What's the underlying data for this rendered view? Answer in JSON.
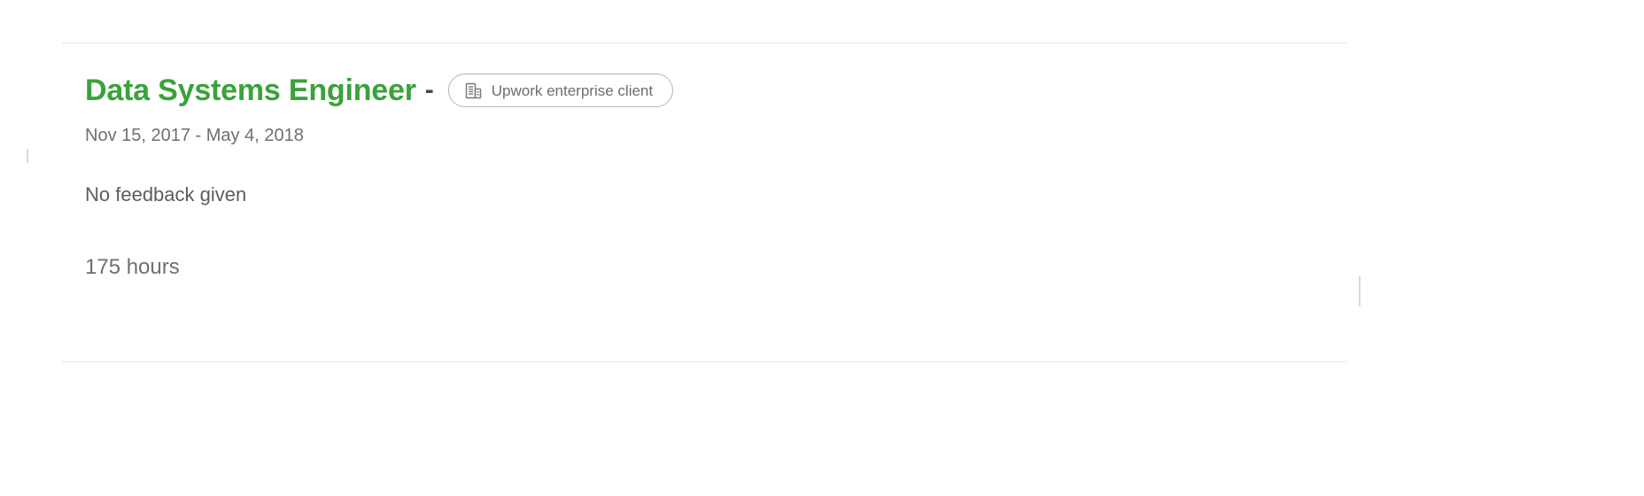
{
  "record": {
    "job_title": "Data Systems Engineer",
    "title_separator": "-",
    "client_badge": {
      "icon": "enterprise-building-icon",
      "label": "Upwork enterprise client"
    },
    "date_range": "Nov 15, 2017 - May 4, 2018",
    "feedback": "No feedback given",
    "hours": "175 hours"
  },
  "colors": {
    "title_green": "#3aa23a",
    "meta_gray": "#6f6f6f",
    "feedback_gray": "#5c5c5c",
    "badge_border": "#b5b5b5",
    "divider": "#e6e6e6",
    "background": "#ffffff"
  }
}
